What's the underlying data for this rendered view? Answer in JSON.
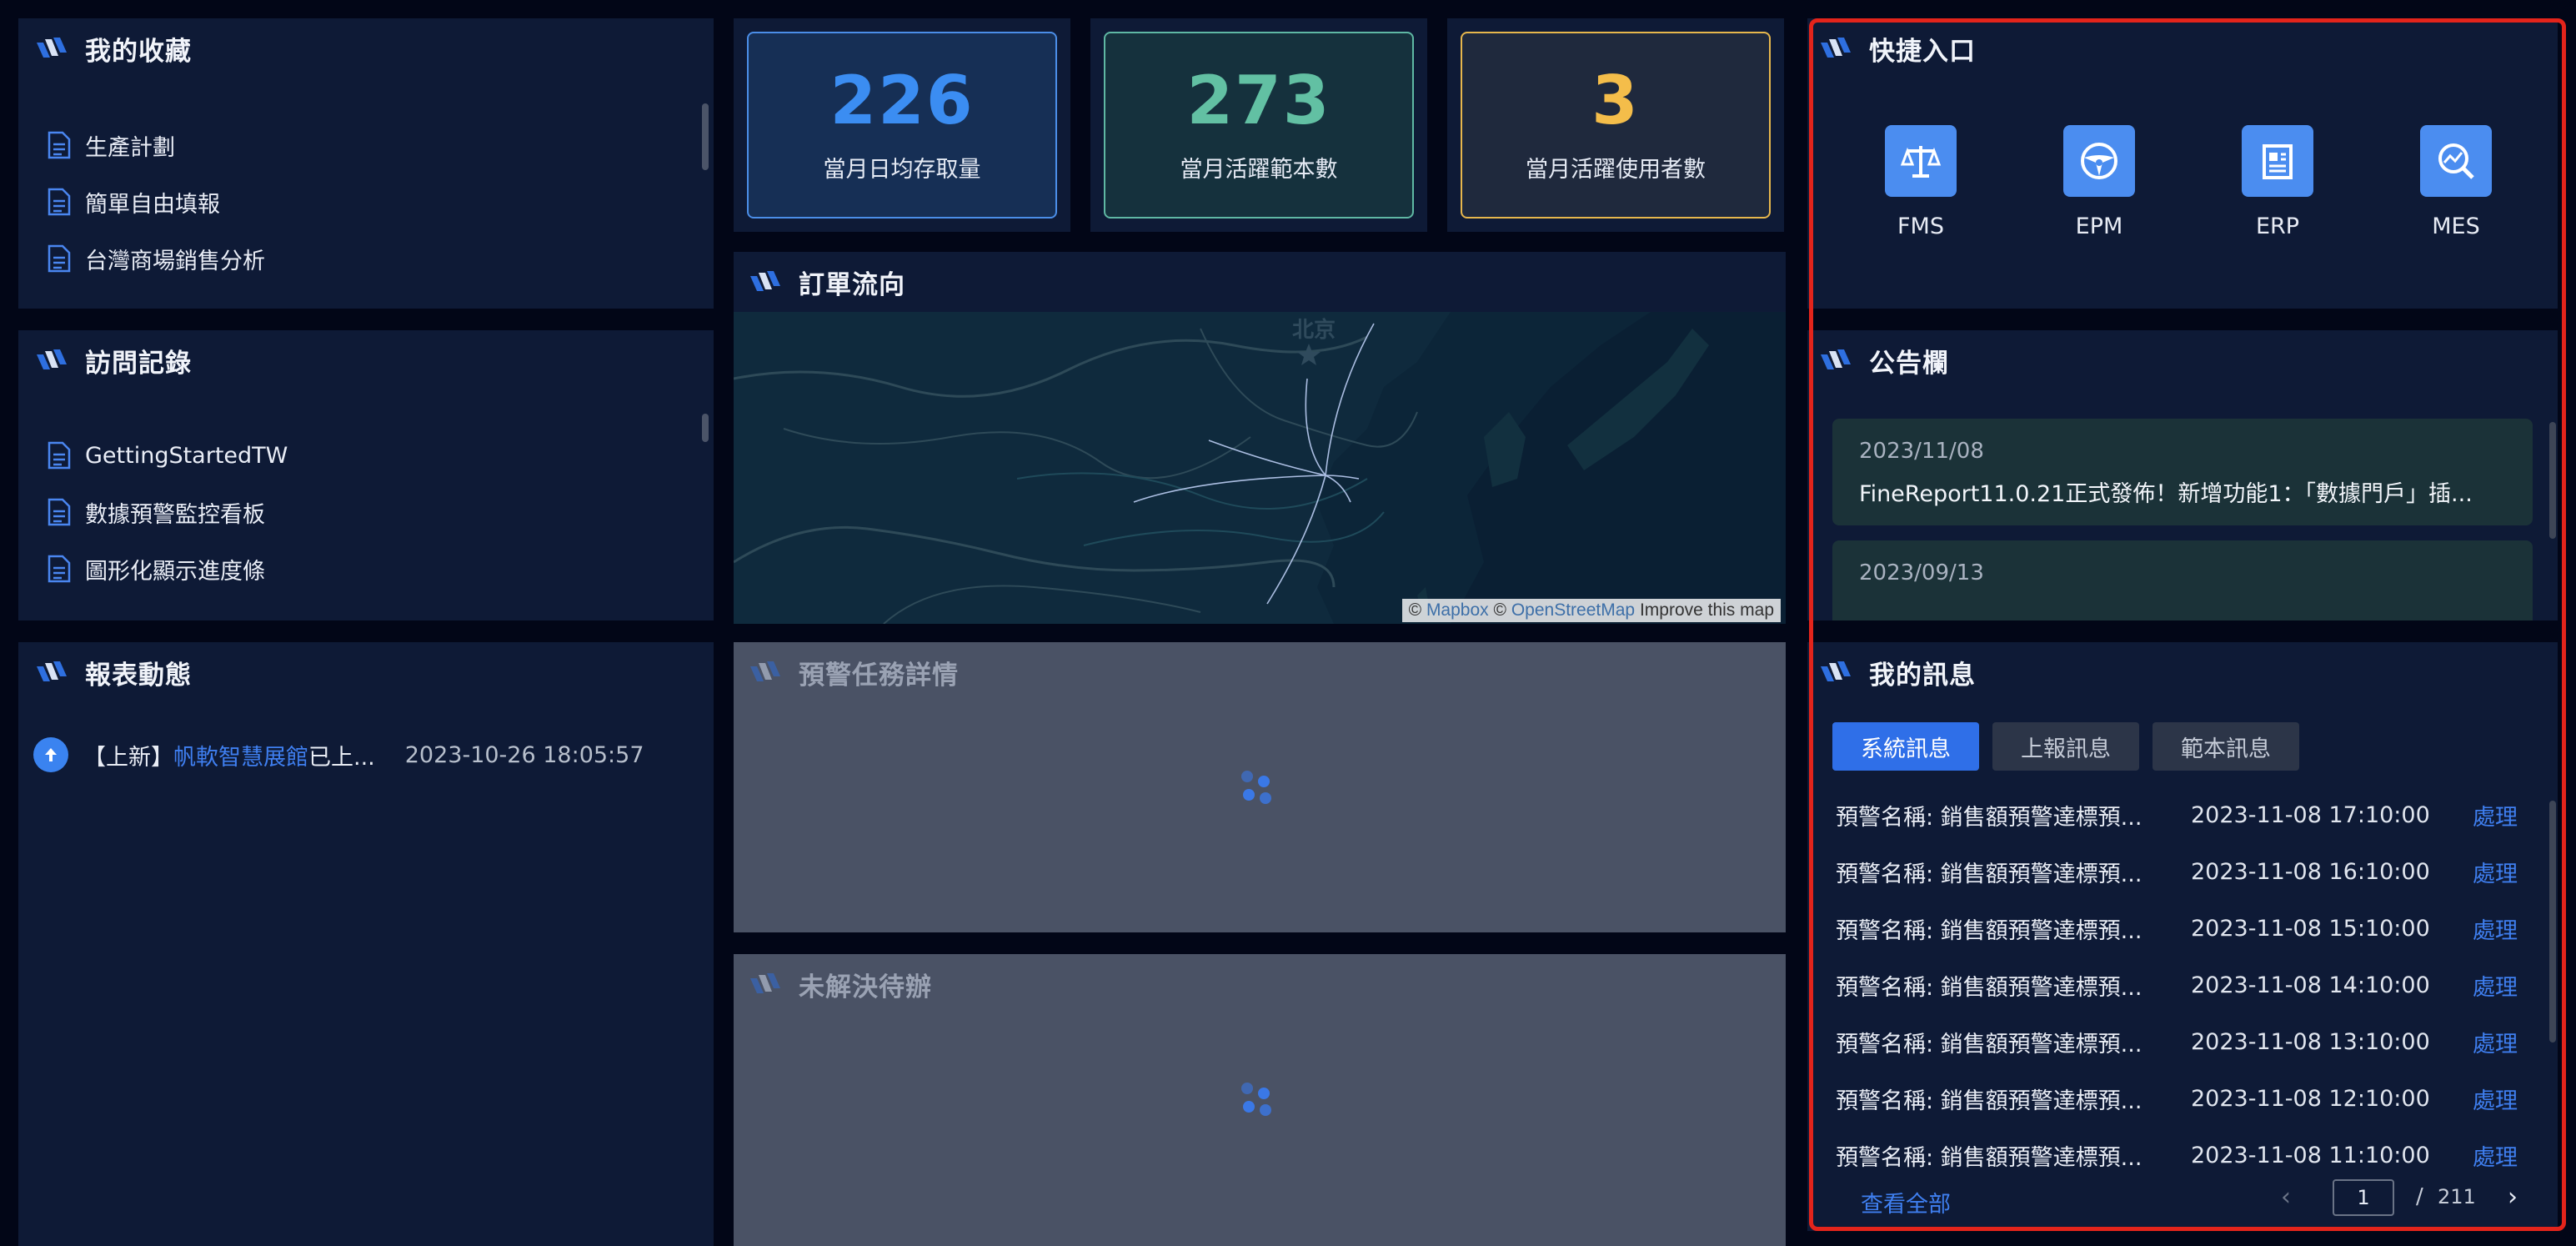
{
  "favorites": {
    "title": "我的收藏",
    "items": [
      "生產計劃",
      "簡單自由填報",
      "台灣商場銷售分析"
    ]
  },
  "history": {
    "title": "訪問記錄",
    "items": [
      "GettingStartedTW",
      "數據預警監控看板",
      "圖形化顯示進度條"
    ]
  },
  "report_activity": {
    "title": "報表動態",
    "tag": "【上新】",
    "link": "帆軟智慧展館",
    "suffix": "已上...",
    "time": "2023-10-26 18:05:57"
  },
  "stats": [
    {
      "value": "226",
      "label": "當月日均存取量",
      "color": "#3b8df2",
      "border": "#4b8ee8",
      "bg": "#162f55"
    },
    {
      "value": "273",
      "label": "當月活躍範本數",
      "color": "#62c0a3",
      "border": "#5fb8a4",
      "bg": "#15313d"
    },
    {
      "value": "3",
      "label": "當月活躍使用者數",
      "color": "#f4bd4a",
      "border": "#e7b74c",
      "bg": "#1f293d"
    }
  ],
  "order_flow": {
    "title": "訂單流向",
    "city_label": "北京",
    "attribution": {
      "prefix": "©",
      "mapbox": "Mapbox",
      "sep": "©",
      "osm": "OpenStreetMap",
      "improve": "Improve this map"
    }
  },
  "alert_tasks": {
    "title": "預警任務詳情"
  },
  "pending": {
    "title": "未解決待辦"
  },
  "quick_entry": {
    "title": "快捷入口",
    "items": [
      {
        "label": "FMS",
        "icon": "balance-scale-icon"
      },
      {
        "label": "EPM",
        "icon": "steering-wheel-icon"
      },
      {
        "label": "ERP",
        "icon": "document-icon"
      },
      {
        "label": "MES",
        "icon": "search-chart-icon"
      }
    ]
  },
  "notice_board": {
    "title": "公告欄",
    "items": [
      {
        "date": "2023/11/08",
        "text": "FineReport11.0.21正式發佈！新增功能1：「數據門戶」插..."
      },
      {
        "date": "2023/09/13",
        "text": ""
      }
    ]
  },
  "messages": {
    "title": "我的訊息",
    "tabs": [
      "系統訊息",
      "上報訊息",
      "範本訊息"
    ],
    "active_tab": 0,
    "rows": [
      {
        "name": "預警名稱: 銷售額預警達標預...",
        "time": "2023-11-08 17:10:00",
        "action": "處理"
      },
      {
        "name": "預警名稱: 銷售額預警達標預...",
        "time": "2023-11-08 16:10:00",
        "action": "處理"
      },
      {
        "name": "預警名稱: 銷售額預警達標預...",
        "time": "2023-11-08 15:10:00",
        "action": "處理"
      },
      {
        "name": "預警名稱: 銷售額預警達標預...",
        "time": "2023-11-08 14:10:00",
        "action": "處理"
      },
      {
        "name": "預警名稱: 銷售額預警達標預...",
        "time": "2023-11-08 13:10:00",
        "action": "處理"
      },
      {
        "name": "預警名稱: 銷售額預警達標預...",
        "time": "2023-11-08 12:10:00",
        "action": "處理"
      },
      {
        "name": "預警名稱: 銷售額預警達標預...",
        "time": "2023-11-08 11:10:00",
        "action": "處理"
      }
    ],
    "view_all": "查看全部",
    "pagination": {
      "current": "1",
      "separator": "/",
      "total": "211"
    }
  }
}
